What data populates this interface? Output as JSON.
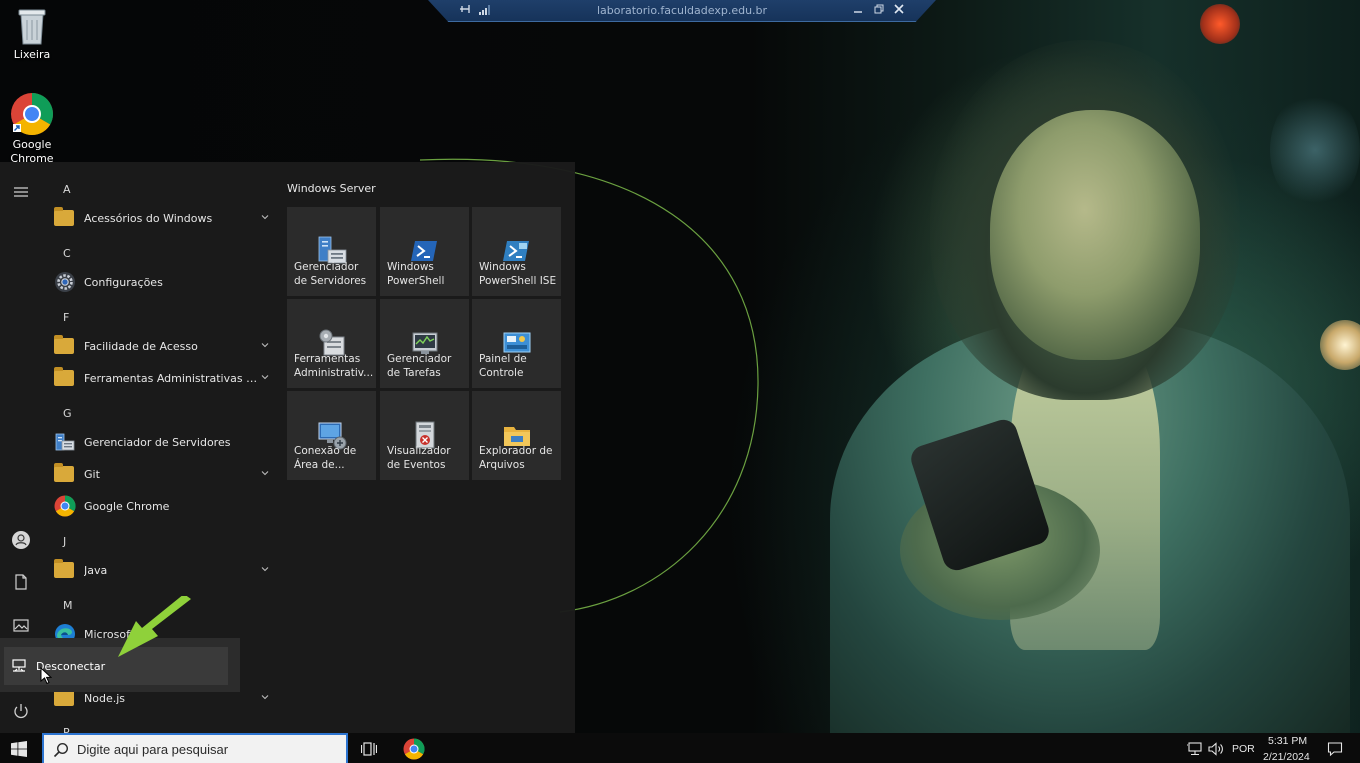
{
  "rdp_bar": {
    "title": "laboratorio.faculdadexp.edu.br"
  },
  "desktop": {
    "icons": [
      {
        "label": "Lixeira",
        "icon": "recycle-bin-icon"
      },
      {
        "label": "Google Chrome",
        "icon": "chrome-icon"
      }
    ]
  },
  "start_menu": {
    "app_list": {
      "sections": [
        {
          "letter": "A",
          "items": [
            {
              "label": "Acessórios do Windows",
              "icon": "folder-icon",
              "expandable": true
            }
          ]
        },
        {
          "letter": "C",
          "items": [
            {
              "label": "Configurações",
              "icon": "gear-icon",
              "expandable": false
            }
          ]
        },
        {
          "letter": "F",
          "items": [
            {
              "label": "Facilidade de Acesso",
              "icon": "folder-icon",
              "expandable": true
            },
            {
              "label": "Ferramentas Administrativas do W...",
              "icon": "folder-icon",
              "expandable": true
            }
          ]
        },
        {
          "letter": "G",
          "items": [
            {
              "label": "Gerenciador de Servidores",
              "icon": "server-manager-icon",
              "expandable": false
            },
            {
              "label": "Git",
              "icon": "folder-icon",
              "expandable": true
            },
            {
              "label": "Google Chrome",
              "icon": "chrome-icon",
              "expandable": false
            }
          ]
        },
        {
          "letter": "J",
          "items": [
            {
              "label": "Java",
              "icon": "folder-icon",
              "expandable": true
            }
          ]
        },
        {
          "letter": "M",
          "items": [
            {
              "label": "Microsoft",
              "icon": "edge-icon",
              "expandable": false
            }
          ]
        },
        {
          "letter": "N",
          "items": [
            {
              "label": "Node.js",
              "icon": "folder-icon",
              "expandable": true
            }
          ]
        }
      ],
      "partial_letter": "P"
    },
    "tiles": {
      "group_title": "Windows Server",
      "items": [
        {
          "label": "Gerenciador de Servidores",
          "icon": "server-manager-icon"
        },
        {
          "label": "Windows PowerShell",
          "icon": "powershell-icon"
        },
        {
          "label": "Windows PowerShell ISE",
          "icon": "powershell-ise-icon"
        },
        {
          "label": "Ferramentas Administrativ...",
          "icon": "admin-tools-icon"
        },
        {
          "label": "Gerenciador de Tarefas",
          "icon": "task-manager-icon"
        },
        {
          "label": "Painel de Controle",
          "icon": "control-panel-icon"
        },
        {
          "label": "Conexão de Área de...",
          "icon": "remote-desktop-icon"
        },
        {
          "label": "Visualizador de Eventos",
          "icon": "event-viewer-icon"
        },
        {
          "label": "Explorador de Arquivos",
          "icon": "file-explorer-icon"
        }
      ]
    },
    "power_flyout": {
      "disconnect_label": "Desconectar"
    }
  },
  "taskbar": {
    "search_placeholder": "Digite aqui para pesquisar",
    "language": "POR",
    "time": "5:31 PM",
    "date": "2/21/2024"
  },
  "colors": {
    "accent": "#2c74d0",
    "folder": "#d9a93a",
    "annotation_arrow": "#8fd13a",
    "rdp_bar": "#1f3f6a"
  }
}
